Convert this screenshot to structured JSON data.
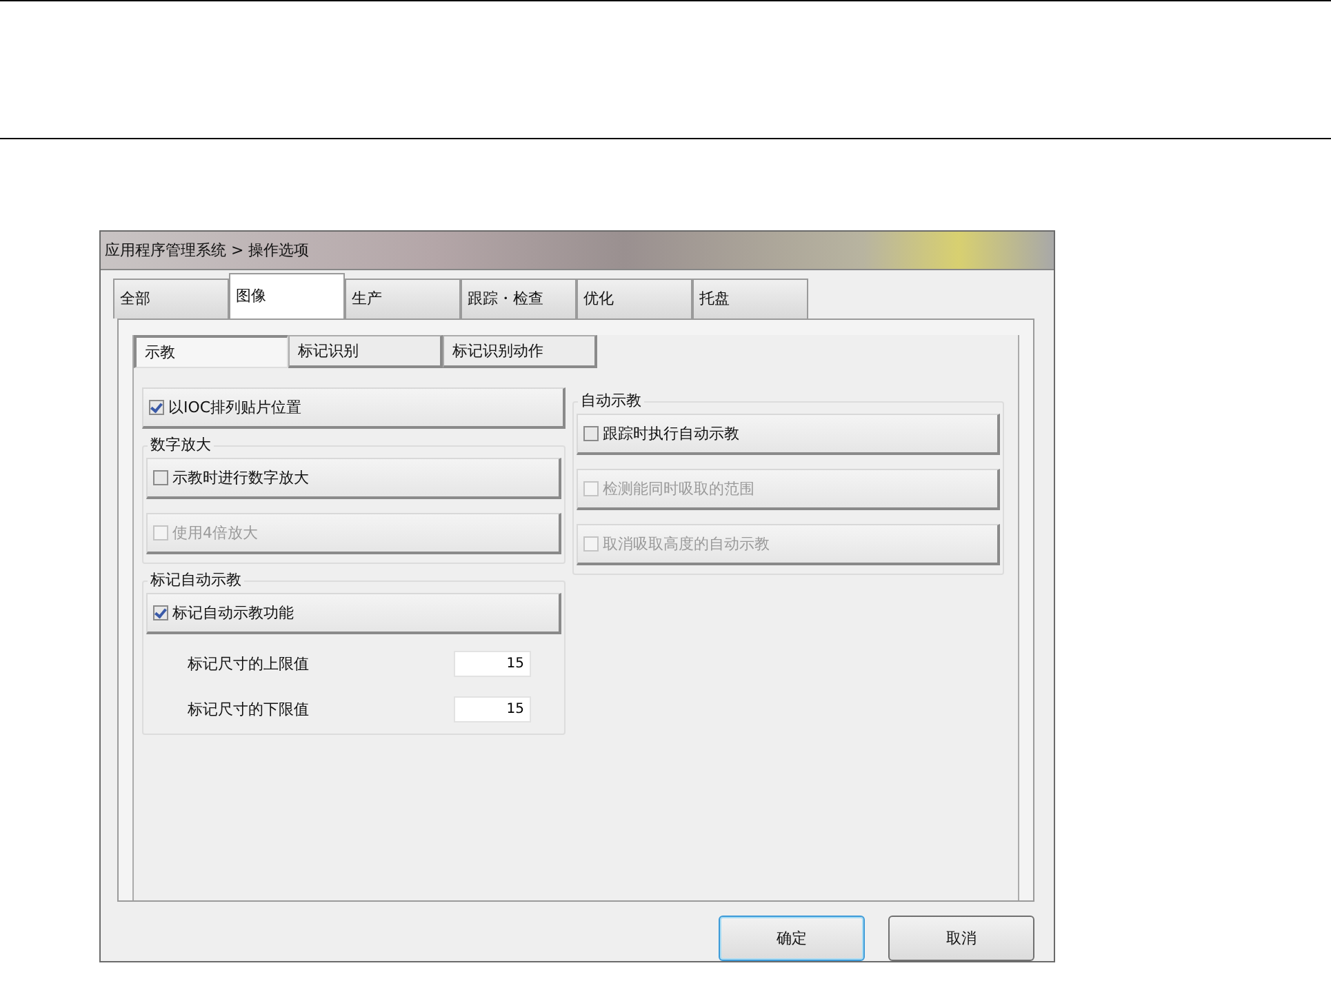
{
  "window": {
    "title": "应用程序管理系统 > 操作选项"
  },
  "tabs": [
    {
      "label": "全部",
      "selected": false
    },
    {
      "label": "图像",
      "selected": true
    },
    {
      "label": "生产",
      "selected": false
    },
    {
      "label": "跟踪・检查",
      "selected": false
    },
    {
      "label": "优化",
      "selected": false
    },
    {
      "label": "托盘",
      "selected": false
    }
  ],
  "subtabs": [
    {
      "label": "示教",
      "selected": true
    },
    {
      "label": "标记识别",
      "selected": false
    },
    {
      "label": "标记识别动作",
      "selected": false
    }
  ],
  "left_column": [
    {
      "kind": "check",
      "label": "以IOC排列贴片位置",
      "checked": true,
      "disabled": false
    },
    {
      "kind": "group",
      "title": "数字放大",
      "items": [
        {
          "kind": "check",
          "label": "示教时进行数字放大",
          "checked": false,
          "disabled": false
        },
        {
          "kind": "check",
          "label": "使用4倍放大",
          "checked": false,
          "disabled": true
        }
      ]
    },
    {
      "kind": "group",
      "title": "标记自动示教",
      "items": [
        {
          "kind": "check",
          "label": "标记自动示教功能",
          "checked": true,
          "disabled": false
        },
        {
          "kind": "number",
          "label": "标记尺寸的上限值",
          "value": "15"
        },
        {
          "kind": "number",
          "label": "标记尺寸的下限值",
          "value": "15"
        }
      ]
    }
  ],
  "right_column": [
    {
      "kind": "group",
      "title": "自动示教",
      "items": [
        {
          "kind": "check",
          "label": "跟踪时执行自动示教",
          "checked": false,
          "disabled": false
        },
        {
          "kind": "check",
          "label": "检测能同时吸取的范围",
          "checked": false,
          "disabled": true
        },
        {
          "kind": "check",
          "label": "取消吸取高度的自动示教",
          "checked": false,
          "disabled": true
        }
      ]
    }
  ],
  "buttons": [
    {
      "label": "确定",
      "default": true
    },
    {
      "label": "取消",
      "default": false
    }
  ]
}
